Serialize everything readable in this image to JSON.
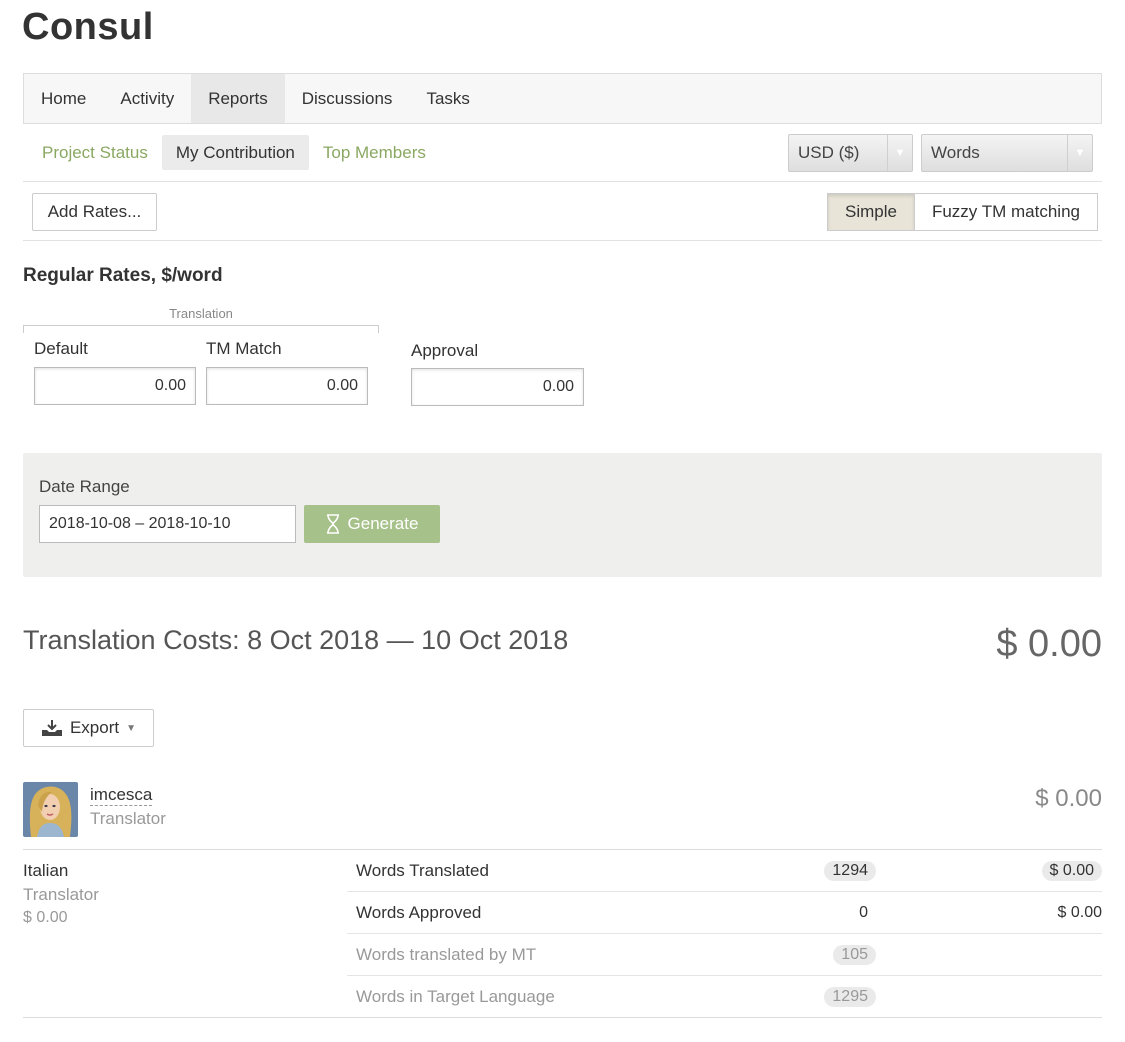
{
  "project": {
    "title": "Consul"
  },
  "nav": {
    "tabs": [
      "Home",
      "Activity",
      "Reports",
      "Discussions",
      "Tasks"
    ],
    "active": "Reports"
  },
  "subnav": {
    "items": [
      "Project Status",
      "My Contribution",
      "Top Members"
    ],
    "active": "My Contribution"
  },
  "filters": {
    "currency": "USD ($)",
    "unit": "Words"
  },
  "toolbar": {
    "add_rates": "Add Rates...",
    "mode_simple": "Simple",
    "mode_fuzzy": "Fuzzy TM matching"
  },
  "rates": {
    "heading": "Regular Rates, $/word",
    "group_label": "Translation",
    "default_label": "Default",
    "default_value": "0.00",
    "tm_label": "TM Match",
    "tm_value": "0.00",
    "approval_label": "Approval",
    "approval_value": "0.00"
  },
  "date_range": {
    "label": "Date Range",
    "value": "2018-10-08 – 2018-10-10",
    "generate": "Generate"
  },
  "costs": {
    "title": "Translation Costs: 8 Oct 2018 — 10 Oct 2018",
    "total": "$ 0.00",
    "export": "Export"
  },
  "user": {
    "name": "imcesca",
    "role": "Translator",
    "total": "$ 0.00"
  },
  "language": {
    "name": "Italian",
    "role": "Translator",
    "amount": "$ 0.00"
  },
  "stats": [
    {
      "label": "Words Translated",
      "count": "1294",
      "amount": "$ 0.00"
    },
    {
      "label": "Words Approved",
      "count": "0",
      "amount": "$ 0.00"
    },
    {
      "label": "Words translated by MT",
      "count": "105",
      "amount": ""
    },
    {
      "label": "Words in Target Language",
      "count": "1295",
      "amount": ""
    }
  ],
  "colors": {
    "link_green": "#8aa862",
    "generate_green": "#a7c18a",
    "panel_gray": "#efefed"
  }
}
